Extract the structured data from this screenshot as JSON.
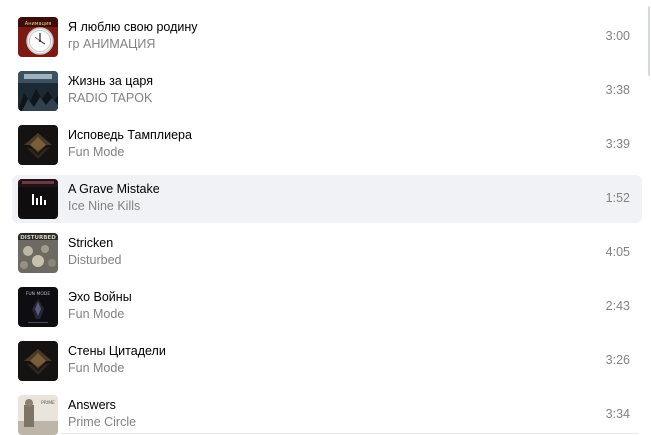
{
  "tracks": [
    {
      "title": "Я люблю свою родину",
      "artist": "гр АНИМАЦИЯ",
      "duration": "3:00",
      "cover": "clock-cover-icon",
      "cover_text": "Анимация"
    },
    {
      "title": "Жизнь за царя",
      "artist": "RADIO TAPOK",
      "duration": "3:38",
      "cover": "battle-cover-icon"
    },
    {
      "title": "Исповедь Тамплиера",
      "artist": "Fun Mode",
      "duration": "3:39",
      "cover": "emblem-cover-icon"
    },
    {
      "title": "A Grave Mistake",
      "artist": "Ice Nine Kills",
      "duration": "1:52",
      "cover": "playing-cover-icon",
      "active": true
    },
    {
      "title": "Stricken",
      "artist": "Disturbed",
      "duration": "4:05",
      "cover": "disturbed-cover-icon",
      "cover_text": "DISTURBED"
    },
    {
      "title": "Эхо Войны",
      "artist": "Fun Mode",
      "duration": "2:43",
      "cover": "echo-cover-icon",
      "cover_text": "FUN MODE"
    },
    {
      "title": "Стены Цитадели",
      "artist": "Fun Mode",
      "duration": "3:26",
      "cover": "emblem-cover-icon"
    },
    {
      "title": "Answers",
      "artist": "Prime Circle",
      "duration": "3:34",
      "cover": "answers-cover-icon",
      "cover_text": "PRIME"
    }
  ],
  "colors": {
    "title": "#000000",
    "secondary": "#828282",
    "active_row": "#f0f2f5"
  }
}
